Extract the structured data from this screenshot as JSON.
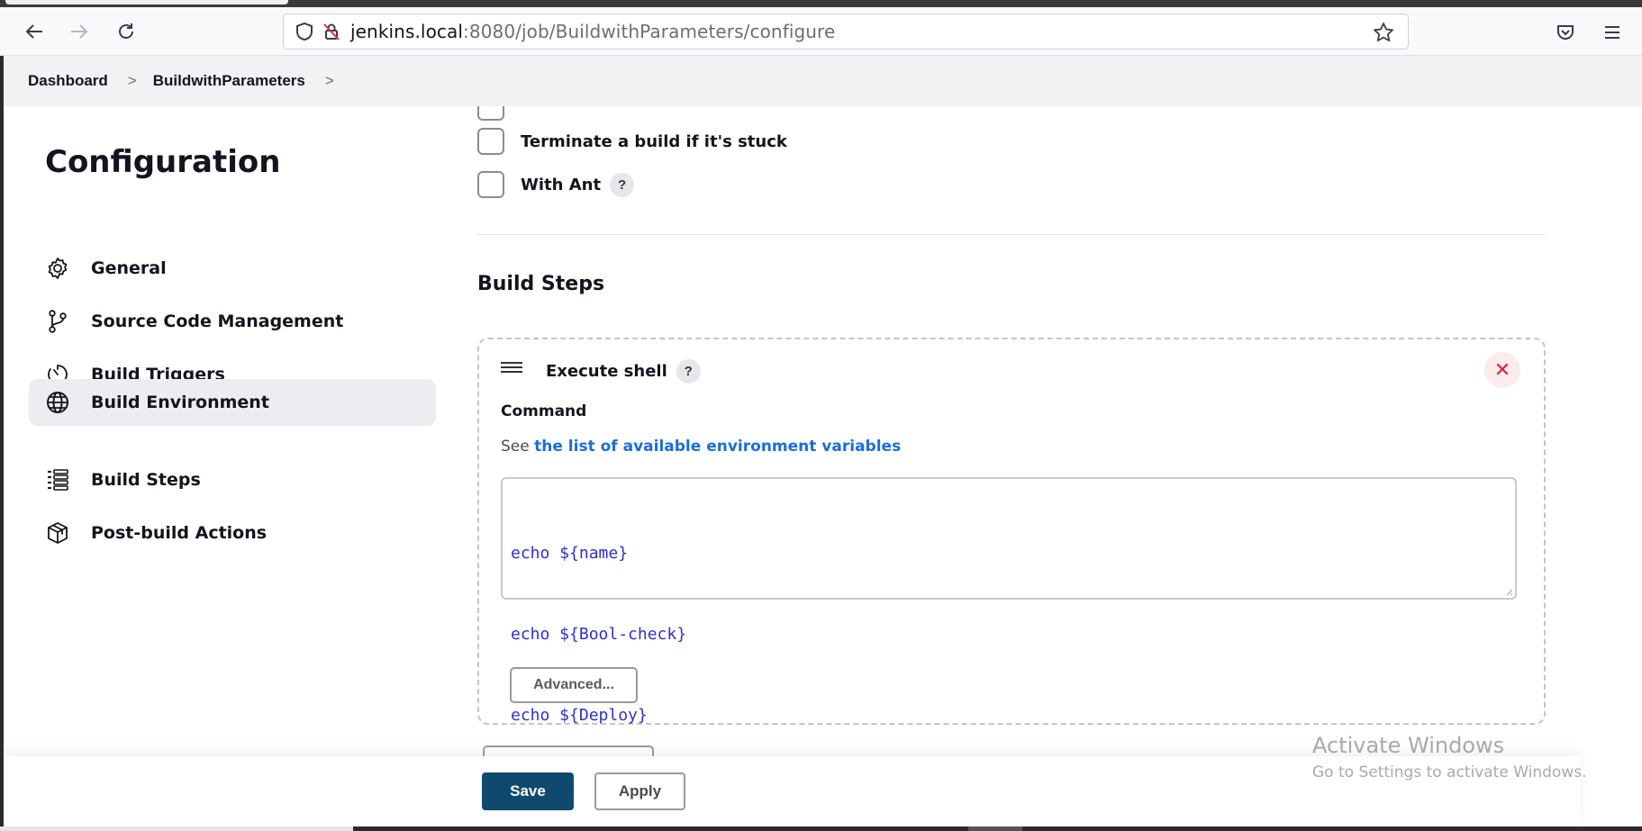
{
  "browser": {
    "url_host": "jenkins.local",
    "url_path": ":8080/job/BuildwithParameters/configure",
    "icons": [
      "back-arrow-icon",
      "forward-arrow-icon",
      "reload-icon",
      "shield-icon",
      "insecure-lock-icon",
      "bookmark-star-icon",
      "pocket-icon",
      "hamburger-menu-icon"
    ]
  },
  "breadcrumb": {
    "items": [
      {
        "label": "Dashboard"
      },
      {
        "label": "BuildwithParameters"
      }
    ],
    "separator": ">"
  },
  "sidebar": {
    "title": "Configuration",
    "items": [
      {
        "label": "General",
        "icon": "gear-icon",
        "active": false
      },
      {
        "label": "Source Code Management",
        "icon": "branch-icon",
        "active": false
      },
      {
        "label": "Build Triggers",
        "icon": "timer-icon",
        "active": false
      },
      {
        "label": "Build Environment",
        "icon": "globe-icon",
        "active": true
      },
      {
        "label": "Build Steps",
        "icon": "list-icon",
        "active": false
      },
      {
        "label": "Post-build Actions",
        "icon": "package-icon",
        "active": false
      }
    ]
  },
  "build_environment": {
    "options": [
      {
        "label": "Terminate a build if it's stuck",
        "checked": false,
        "help": false
      },
      {
        "label": "With Ant",
        "checked": false,
        "help": true
      }
    ]
  },
  "build_steps": {
    "title": "Build Steps",
    "step": {
      "title": "Execute shell",
      "help": "?",
      "close_symbol": "✕",
      "command_label": "Command",
      "see_prefix": "See",
      "see_link": "the list of available environment variables",
      "command_lines": [
        "echo ${name}",
        "echo ${Bool-check}",
        "echo ${Deploy}"
      ],
      "advanced_label": "Advanced..."
    }
  },
  "actions": {
    "save_label": "Save",
    "apply_label": "Apply"
  },
  "watermark": {
    "title": "Activate Windows",
    "subtitle": "Go to Settings to activate Windows."
  },
  "colors": {
    "primary_button": "#0f4a6e",
    "link": "#1a6fd6",
    "close": "#e0242b",
    "active_nav_bg": "#ececf1"
  }
}
